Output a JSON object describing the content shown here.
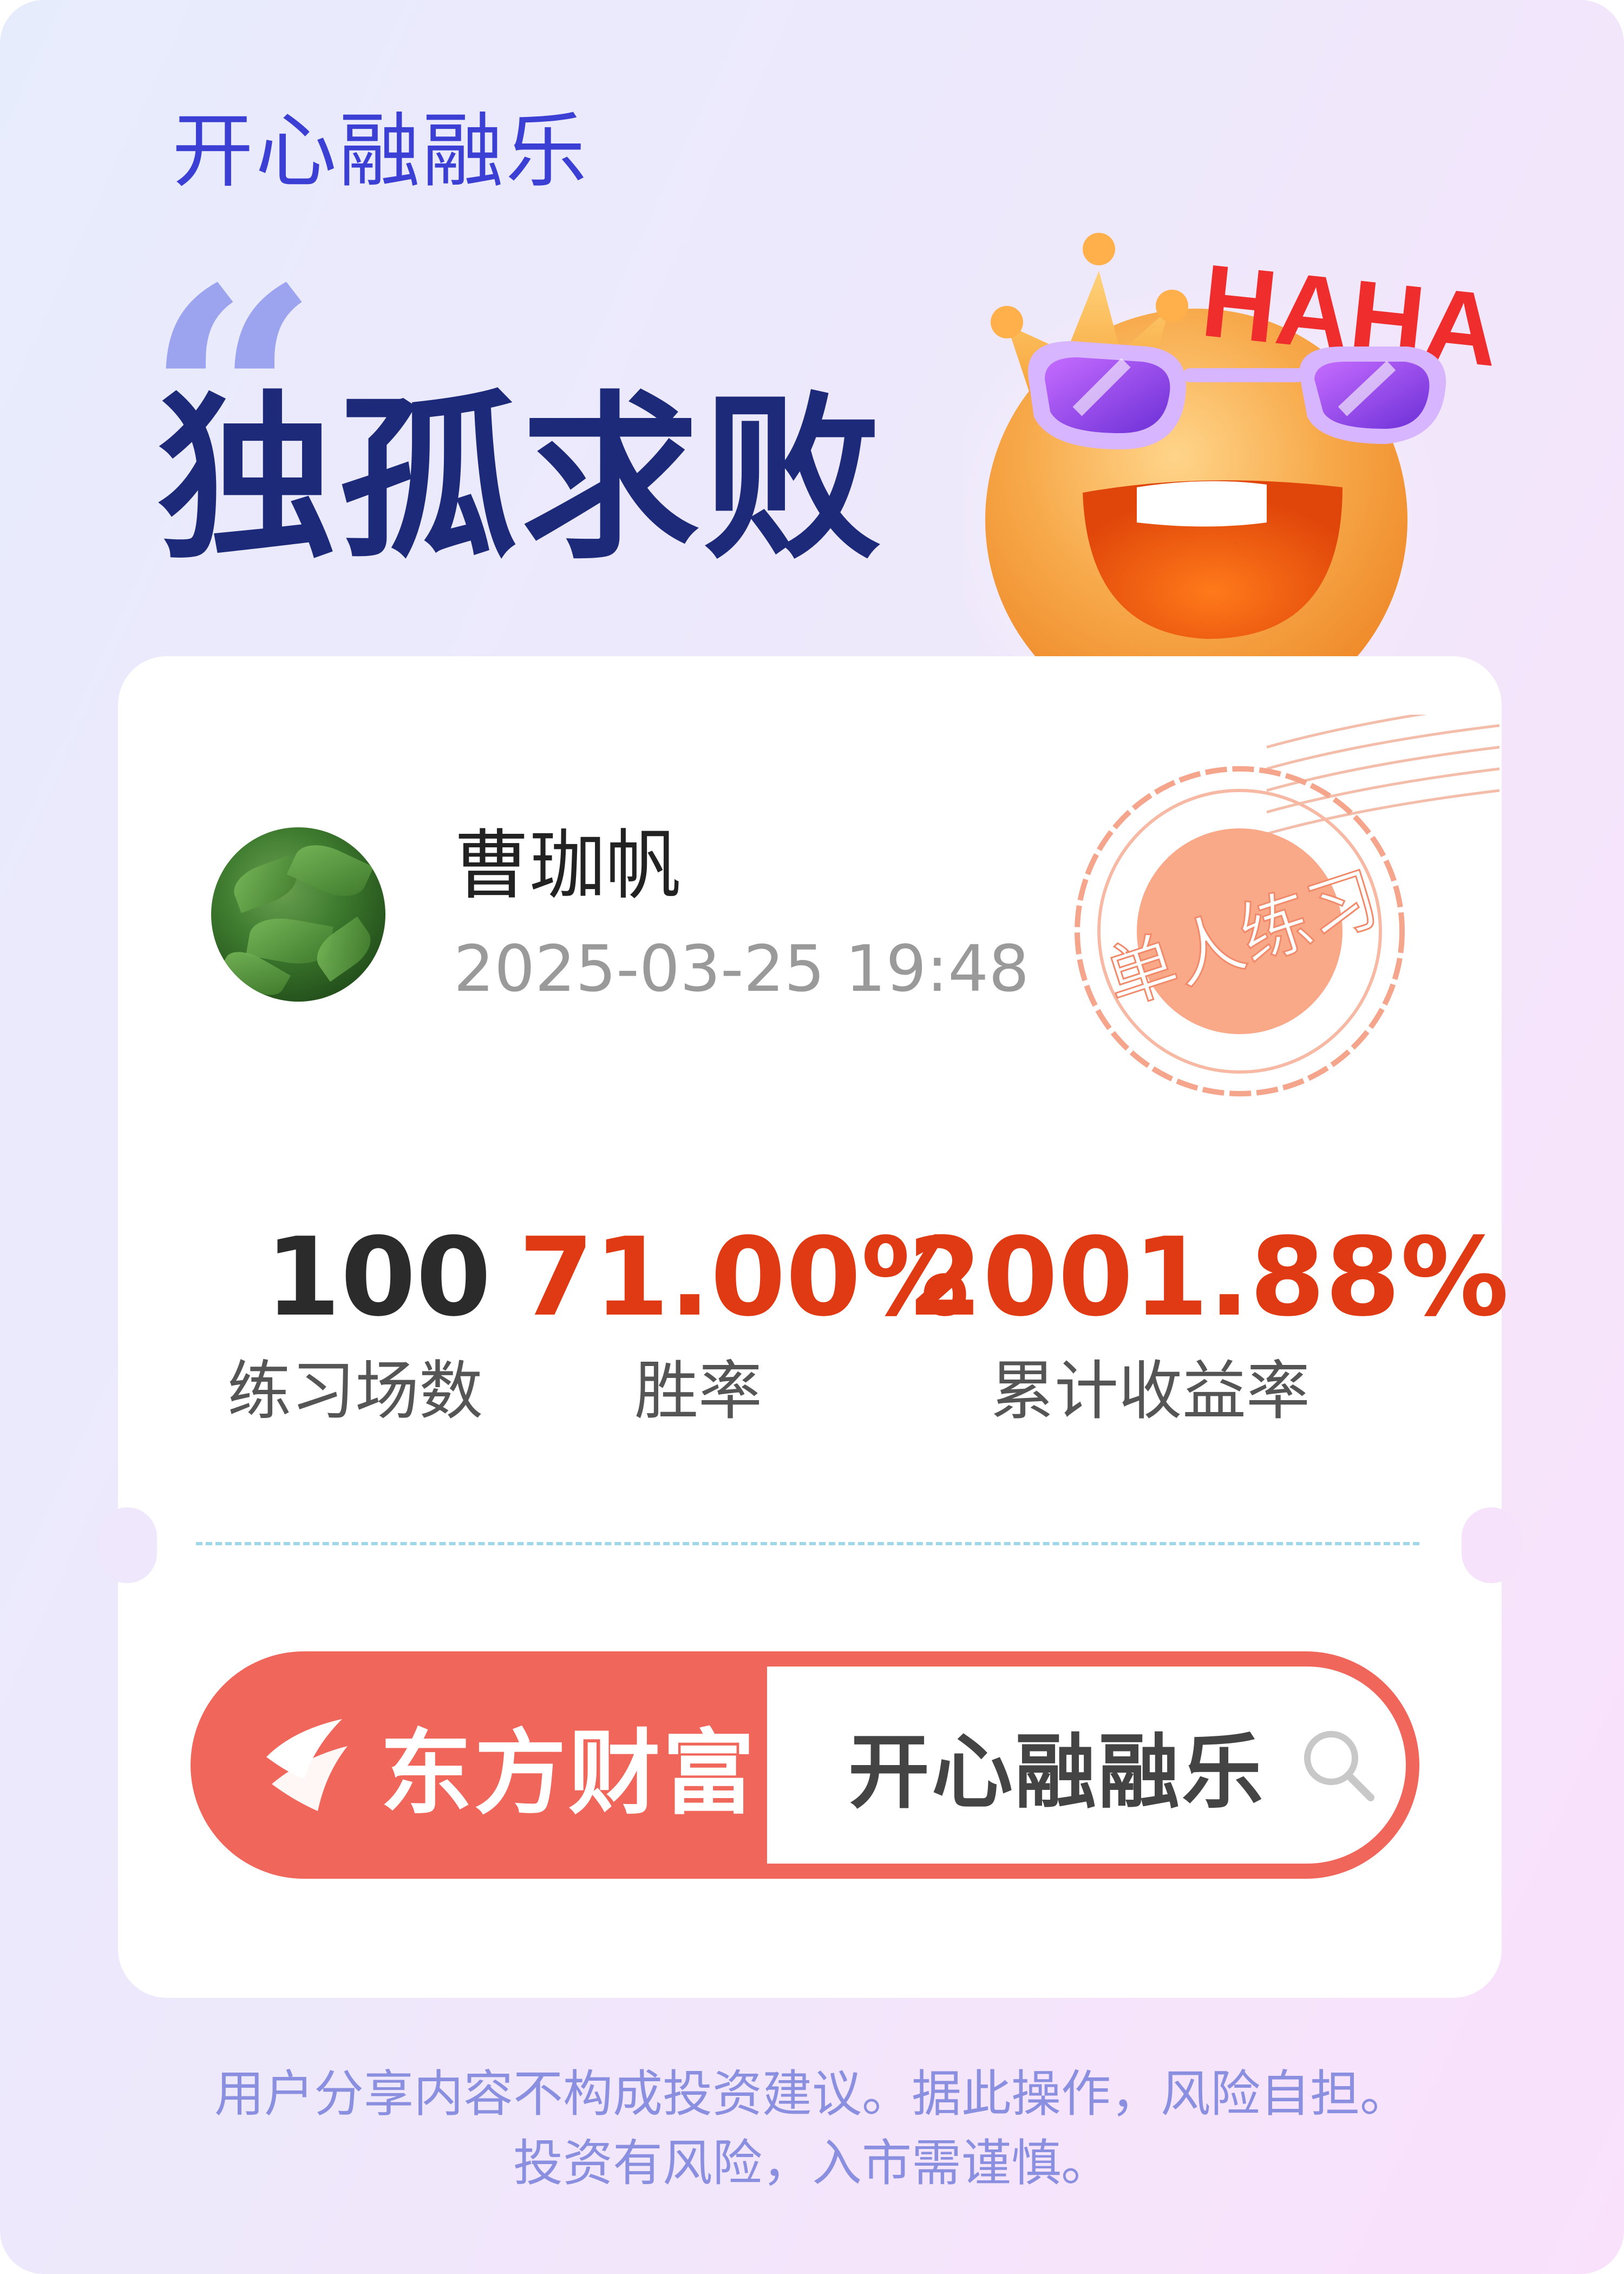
{
  "app": {
    "name": "开心融融乐"
  },
  "headline": "独孤求败",
  "sticker": {
    "text": "HAHA"
  },
  "user": {
    "name": "曹珈帆",
    "datetime": "2025-03-25 19:48"
  },
  "stamp": {
    "text": "单人练习"
  },
  "stats": [
    {
      "value": "100",
      "label": "练习场数",
      "color": "#2b2b2b"
    },
    {
      "value": "71.00%",
      "label": "胜率",
      "color": "#e03a14"
    },
    {
      "value": "2001.88%",
      "label": "累计收益率",
      "color": "#e03a14"
    }
  ],
  "brand": {
    "name": "东方财富",
    "search_text": "开心融融乐",
    "color": "#f0665a"
  },
  "disclaimer": {
    "line1": "用户分享内容不构成投资建议。据此操作，风险自担。",
    "line2": "投资有风险，入市需谨慎。"
  }
}
